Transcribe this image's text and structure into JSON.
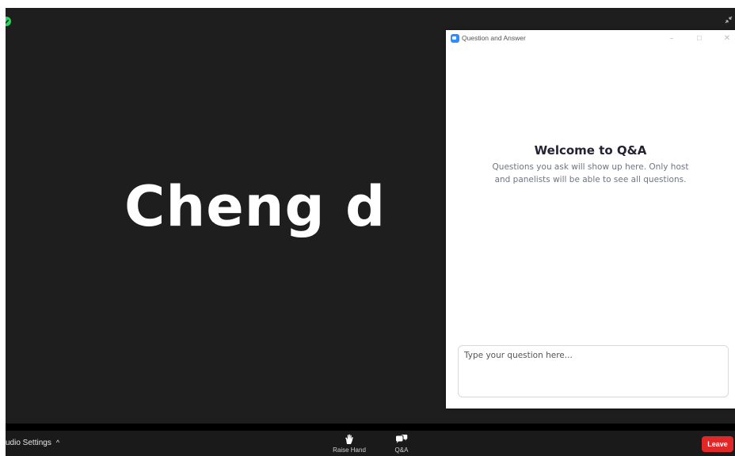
{
  "video": {
    "speaker_name": "Cheng d",
    "icons": {
      "security": "shield-check-icon",
      "exit_fullscreen": "exit-fullscreen-icon"
    }
  },
  "toolbar": {
    "audio_settings": "udio Settings",
    "audio_caret": "^",
    "raise_hand": "Raise Hand",
    "qa": "Q&A",
    "leave": "Leave",
    "icons": {
      "raise_hand": "raise-hand-icon",
      "qa": "qa-chat-icon"
    }
  },
  "qa_window": {
    "title": "Question and Answer",
    "minimize": "–",
    "maximize": "☐",
    "close": "✕",
    "welcome_title": "Welcome to Q&A",
    "welcome_text": "Questions you ask will show up here. Only host and panelists will be able to see all questions.",
    "question_placeholder": "Type your question here..."
  },
  "colors": {
    "video_bg": "#1e1e1e",
    "toolbar_bg": "#1a1a1a",
    "leave_red": "#e02828",
    "zoom_blue": "#2d8cff",
    "security_green": "#23d959"
  }
}
